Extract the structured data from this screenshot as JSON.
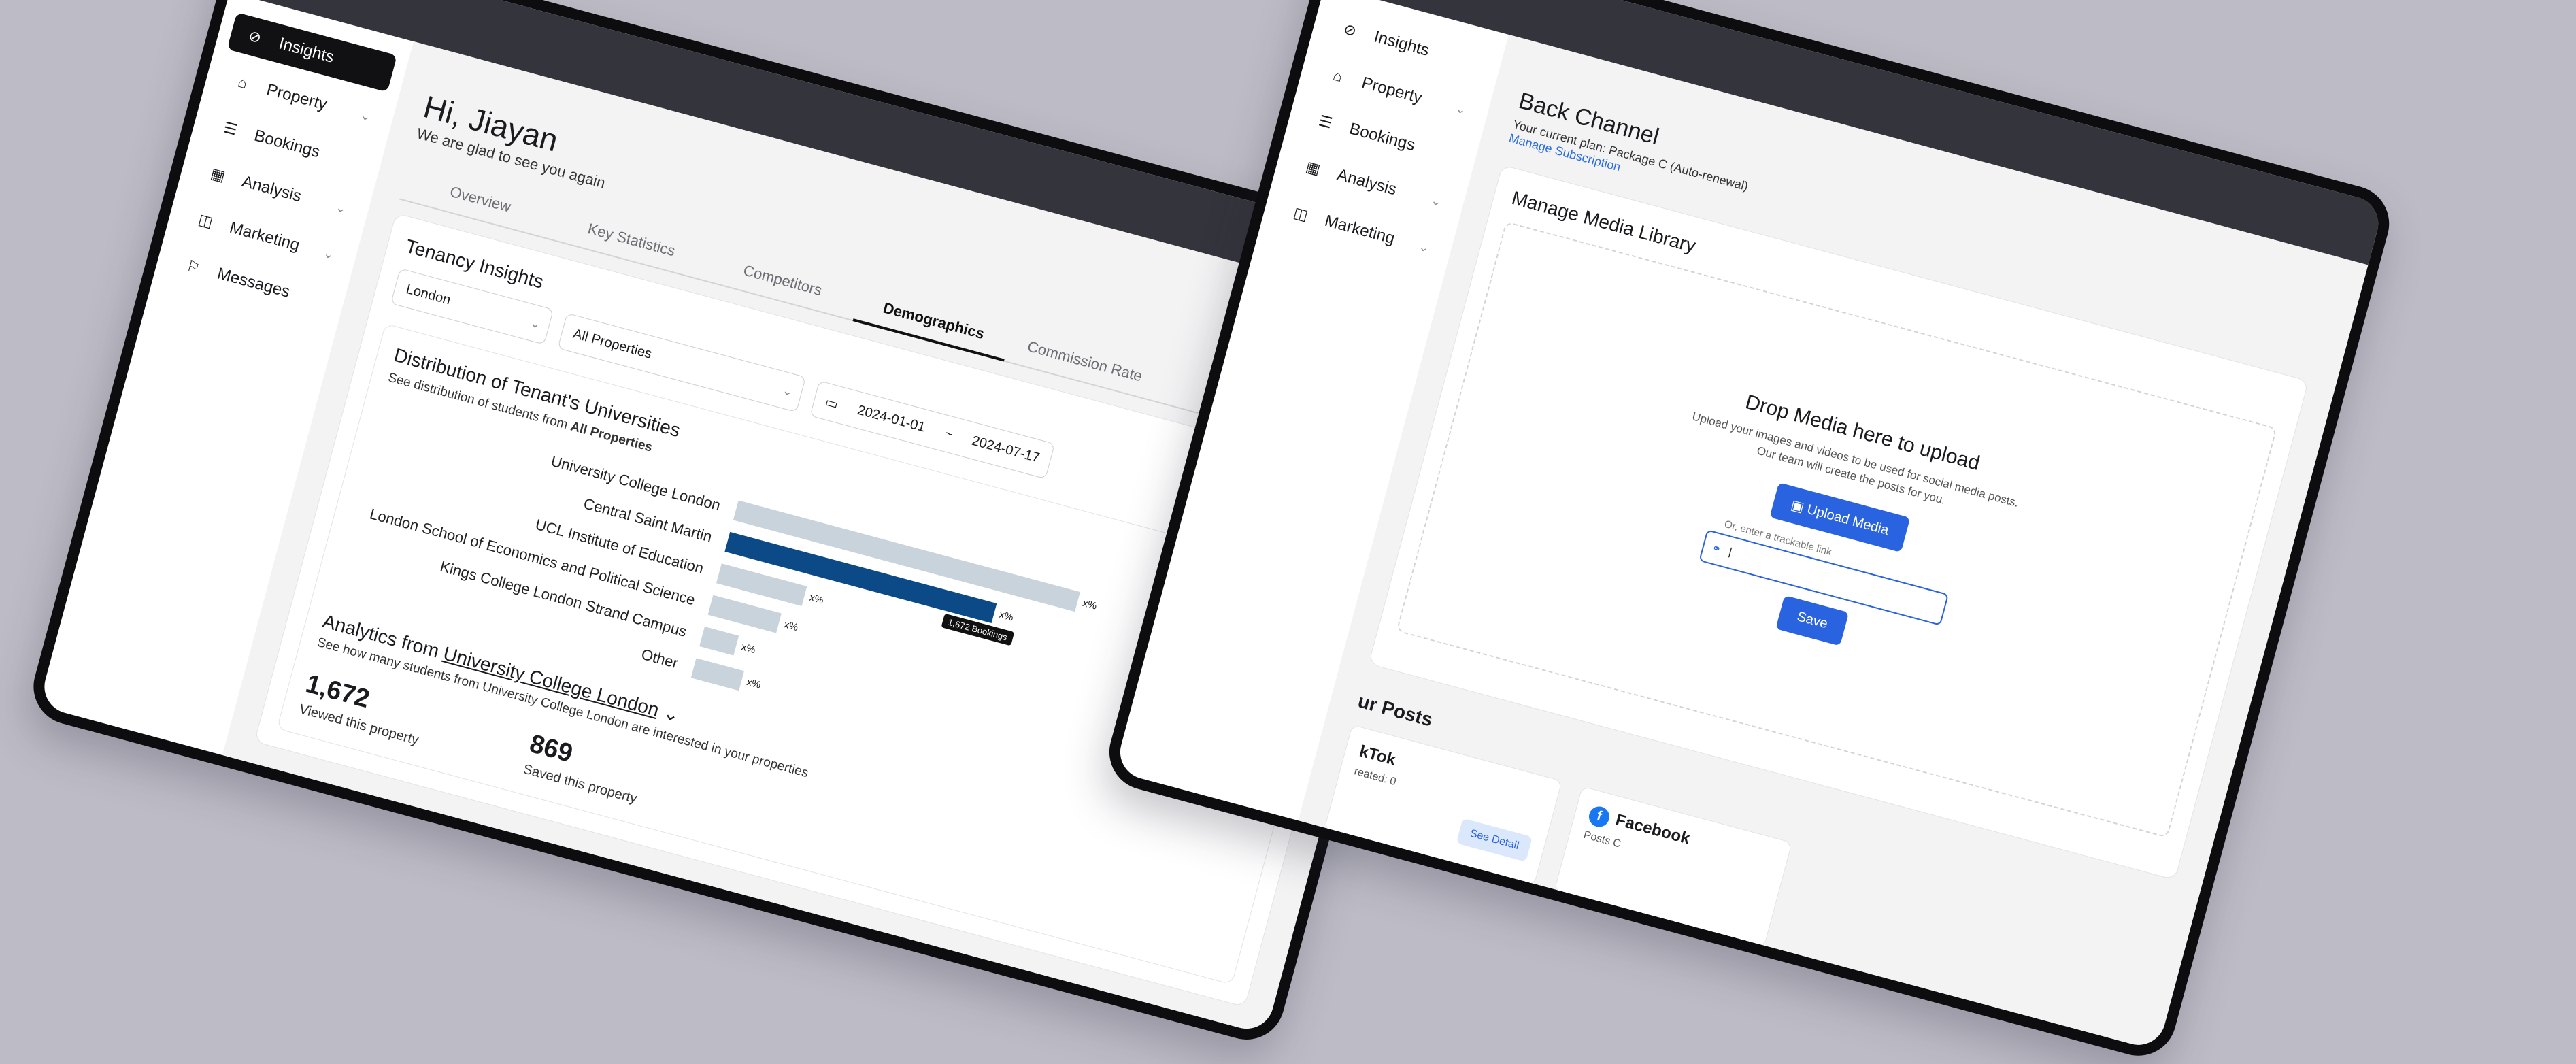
{
  "window1": {
    "sidebar": [
      {
        "label": "Insights",
        "icon": "compass-icon",
        "active": true,
        "chevron": false
      },
      {
        "label": "Property",
        "icon": "home-icon",
        "active": false,
        "chevron": true
      },
      {
        "label": "Bookings",
        "icon": "list-icon",
        "active": false,
        "chevron": false
      },
      {
        "label": "Analysis",
        "icon": "table-icon",
        "active": false,
        "chevron": true
      },
      {
        "label": "Marketing",
        "icon": "megaphone-icon",
        "active": false,
        "chevron": true
      },
      {
        "label": "Messages",
        "icon": "flag-icon",
        "active": false,
        "chevron": false
      }
    ],
    "greeting": "Hi, Jiayan",
    "subgreeting": "We are glad to see you again",
    "tabs": [
      "Overview",
      "Key Statistics",
      "Competitors",
      "Demographics",
      "Commission Rate"
    ],
    "active_tab": "Demographics",
    "card_title": "Tenancy Insights",
    "filters": {
      "city": "London",
      "property": "All Properties",
      "date_from": "2024-01-01",
      "date_sep": "~",
      "date_to": "2024-07-17"
    },
    "distribution": {
      "title": "Distribution of Tenant's Universities",
      "subtitle_prefix": "See distribution of students from ",
      "subtitle_bold": "All Properties"
    },
    "chart_data": {
      "type": "bar",
      "categories": [
        "University College London",
        "Central Saint Martin",
        "UCL Institute of Education",
        "London School of Economics and Political Science",
        "Kings College London Strand Campus",
        "Other"
      ],
      "values": [
        1,
        0.78,
        0.25,
        0.2,
        0.1,
        0.14
      ],
      "value_labels": [
        "x%",
        "x%",
        "x%",
        "x%",
        "x%",
        "x%"
      ],
      "highlight_index": 1,
      "tooltip": "1,672 Bookings"
    },
    "analytics": {
      "title_prefix": "Analytics from ",
      "title_link": "University College London",
      "subtitle": "See how many students from University College London are interested in your properties",
      "stats": [
        {
          "value": "1,672",
          "label": "Viewed this property"
        },
        {
          "value": "869",
          "label": "Saved this property"
        }
      ]
    }
  },
  "window2": {
    "sidebar": [
      {
        "label": "Insights",
        "icon": "compass-icon",
        "chevron": false
      },
      {
        "label": "Property",
        "icon": "home-icon",
        "chevron": true
      },
      {
        "label": "Bookings",
        "icon": "list-icon",
        "chevron": false
      },
      {
        "label": "Analysis",
        "icon": "table-icon",
        "chevron": true
      },
      {
        "label": "Marketing",
        "icon": "megaphone-icon",
        "chevron": true
      }
    ],
    "title": "Back Channel",
    "plan_text": "Your current plan: Package C (Auto-renewal)",
    "manage_link": "Manage Subscription",
    "media_title": "Manage Media Library",
    "drop_title": "Drop Media here to upload",
    "drop_sub_1": "Upload your images and videos to be used for social media posts.",
    "drop_sub_2": "Our team will create the posts for you.",
    "upload_button": "Upload Media",
    "link_hint": "Or, enter a trackable link",
    "save_button": "Save",
    "posts_title": "ur Posts",
    "post_cards": [
      {
        "name": "kTok",
        "meta": "reated: 0",
        "button": "See Detail"
      },
      {
        "name": "Facebook",
        "meta": "Posts C"
      }
    ]
  }
}
